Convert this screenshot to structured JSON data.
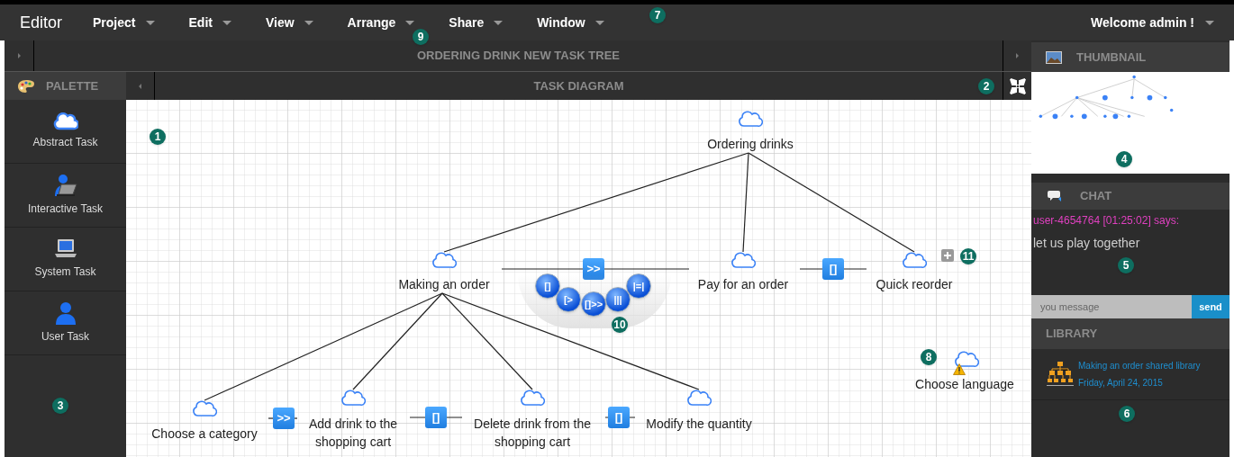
{
  "menu_bar": {
    "app_title": "Editor",
    "menus": [
      {
        "label": "Project"
      },
      {
        "label": "Edit"
      },
      {
        "label": "View"
      },
      {
        "label": "Arrange"
      },
      {
        "label": "Share"
      },
      {
        "label": "Window"
      }
    ],
    "user_menu": "Welcome admin !",
    "callouts": [
      "7",
      "9"
    ]
  },
  "document_title": "ORDERING DRINK NEW TASK TREE",
  "palette": {
    "title": "PALETTE",
    "callout": "3",
    "items": [
      {
        "label": "Abstract Task",
        "kind": "abstract"
      },
      {
        "label": "Interactive Task",
        "kind": "interactive"
      },
      {
        "label": "System Task",
        "kind": "system"
      },
      {
        "label": "User Task",
        "kind": "user"
      }
    ]
  },
  "diagram": {
    "title": "TASK DIAGRAM",
    "callout": "2",
    "canvas_callout": "1",
    "tree": {
      "label": "Ordering drinks",
      "kind": "abstract",
      "children": [
        {
          "label": "Making an order",
          "kind": "abstract",
          "operator_next": ">>",
          "children": [
            {
              "label": "Choose a category",
              "kind": "abstract",
              "operator_next": ">>"
            },
            {
              "label": "Add drink to the shopping cart",
              "kind": "abstract",
              "operator_next": "[]"
            },
            {
              "label": "Delete drink from the shopping cart",
              "kind": "abstract",
              "operator_next": "[]"
            },
            {
              "label": "Modify the quantity",
              "kind": "abstract"
            }
          ]
        },
        {
          "label": "Pay for an order",
          "kind": "abstract",
          "operator_next": "[]"
        },
        {
          "label": "Quick reorder",
          "kind": "abstract",
          "collapsed": true,
          "callout": "11"
        }
      ]
    },
    "loose_nodes": [
      {
        "label": "Choose language",
        "kind": "abstract",
        "warning": true,
        "callout": "8"
      }
    ],
    "operator_menu": {
      "operators": [
        "[]",
        "[>",
        "[]>>",
        "|||",
        "|=|"
      ],
      "callout": "10"
    }
  },
  "thumbnail": {
    "title": "THUMBNAIL",
    "callout": "4"
  },
  "chat": {
    "title": "CHAT",
    "callout": "5",
    "messages": [
      {
        "author": "user-4654764 [01:25:02] says:",
        "text": "let us play together"
      }
    ],
    "input": {
      "placeholder": "you message"
    },
    "send": "send"
  },
  "library": {
    "title": "LIBRARY",
    "callout": "6",
    "items": [
      {
        "name": "Making an order shared library",
        "date": "Friday, April 24, 2015"
      }
    ]
  }
}
